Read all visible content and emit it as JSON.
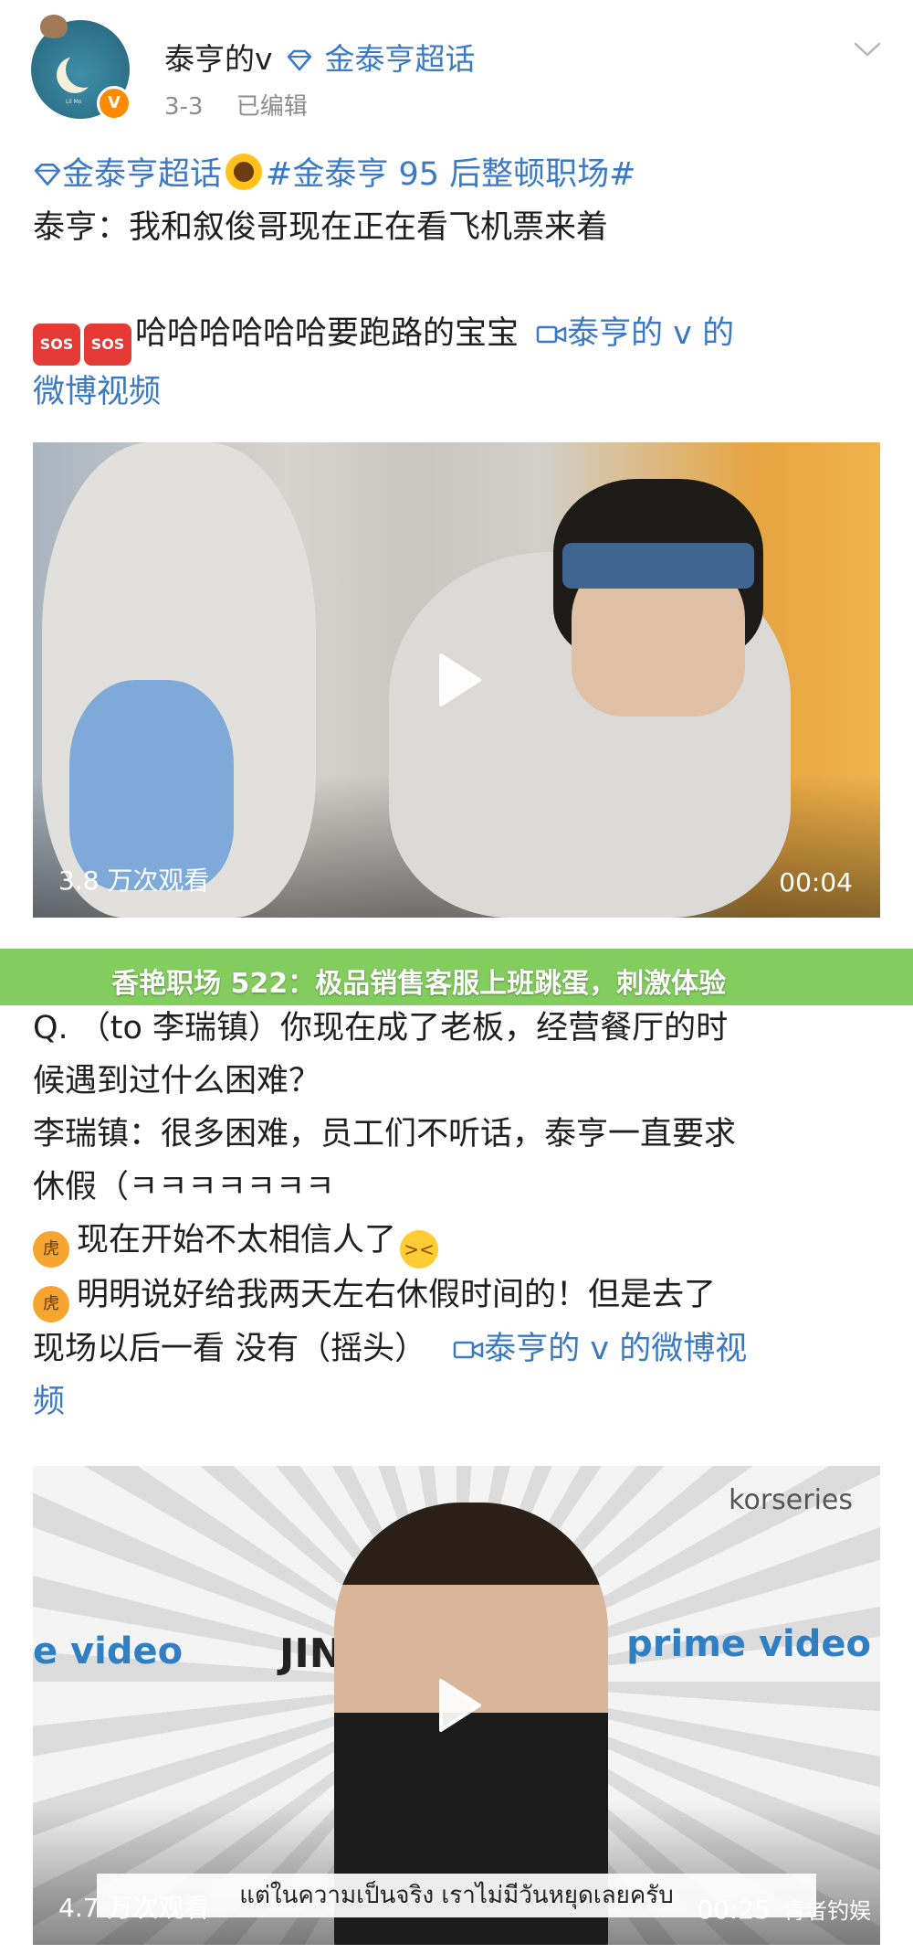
{
  "post": {
    "author_name": "泰亨的v",
    "author_topic": "金泰亨超话",
    "date": "3-3",
    "edited": "已编辑",
    "avatar_caption": "Lil Mo"
  },
  "block1": {
    "topic_link": "金泰亨超话",
    "hashtag": "#金泰亨 95 后整顿职场#",
    "line2": "泰亨：我和叙俊哥现在正在看飞机票来着",
    "sos1": "SOS",
    "sos2": "SOS",
    "laugh_text": "哈哈哈哈哈哈要跑路的宝宝",
    "video_link_a": "泰亨的 v 的",
    "video_link_b": "微博视频"
  },
  "video1": {
    "views": "3.8 万次观看",
    "duration": "00:04"
  },
  "banner": {
    "text": "香艳职场 522：极品销售客服上班跳蛋，刺激体验"
  },
  "block2": {
    "q_line1": "Q. （to 李瑞镇）你现在成了老板，经营餐厅的时",
    "q_line2": "候遇到过什么困难？",
    "a_line1": "李瑞镇：很多困难，员工们不听话，泰亨一直要求",
    "a_line2": "休假（ㅋㅋㅋㅋㅋㅋㅋ",
    "t_line1": "现在开始不太相信人了",
    "t_line2": "明明说好给我两天左右休假时间的！但是去了",
    "t_line3": "现场以后一看 没有（摇头）",
    "video_link_a": "泰亨的 v 的微博视",
    "video_link_b": "频"
  },
  "video2": {
    "brand": "korseries",
    "prime_left": "e video",
    "prime_right": "prime video",
    "jin_logo": "JIN",
    "subtitle": "แต่ในความเป็นจริง เราไม่มีวันหยุดเลยครับ",
    "views": "4.7 万次观看",
    "duration": "00:25",
    "watermark": "青者钓娱"
  },
  "colors": {
    "link": "#3b79c4",
    "banner": "#78c850",
    "vip": "#ff8a00"
  },
  "icons": {
    "chevron": "chevron-down-icon",
    "play": "play-icon",
    "video_link": "video-link-icon",
    "diamond": "super-topic-diamond-icon"
  }
}
